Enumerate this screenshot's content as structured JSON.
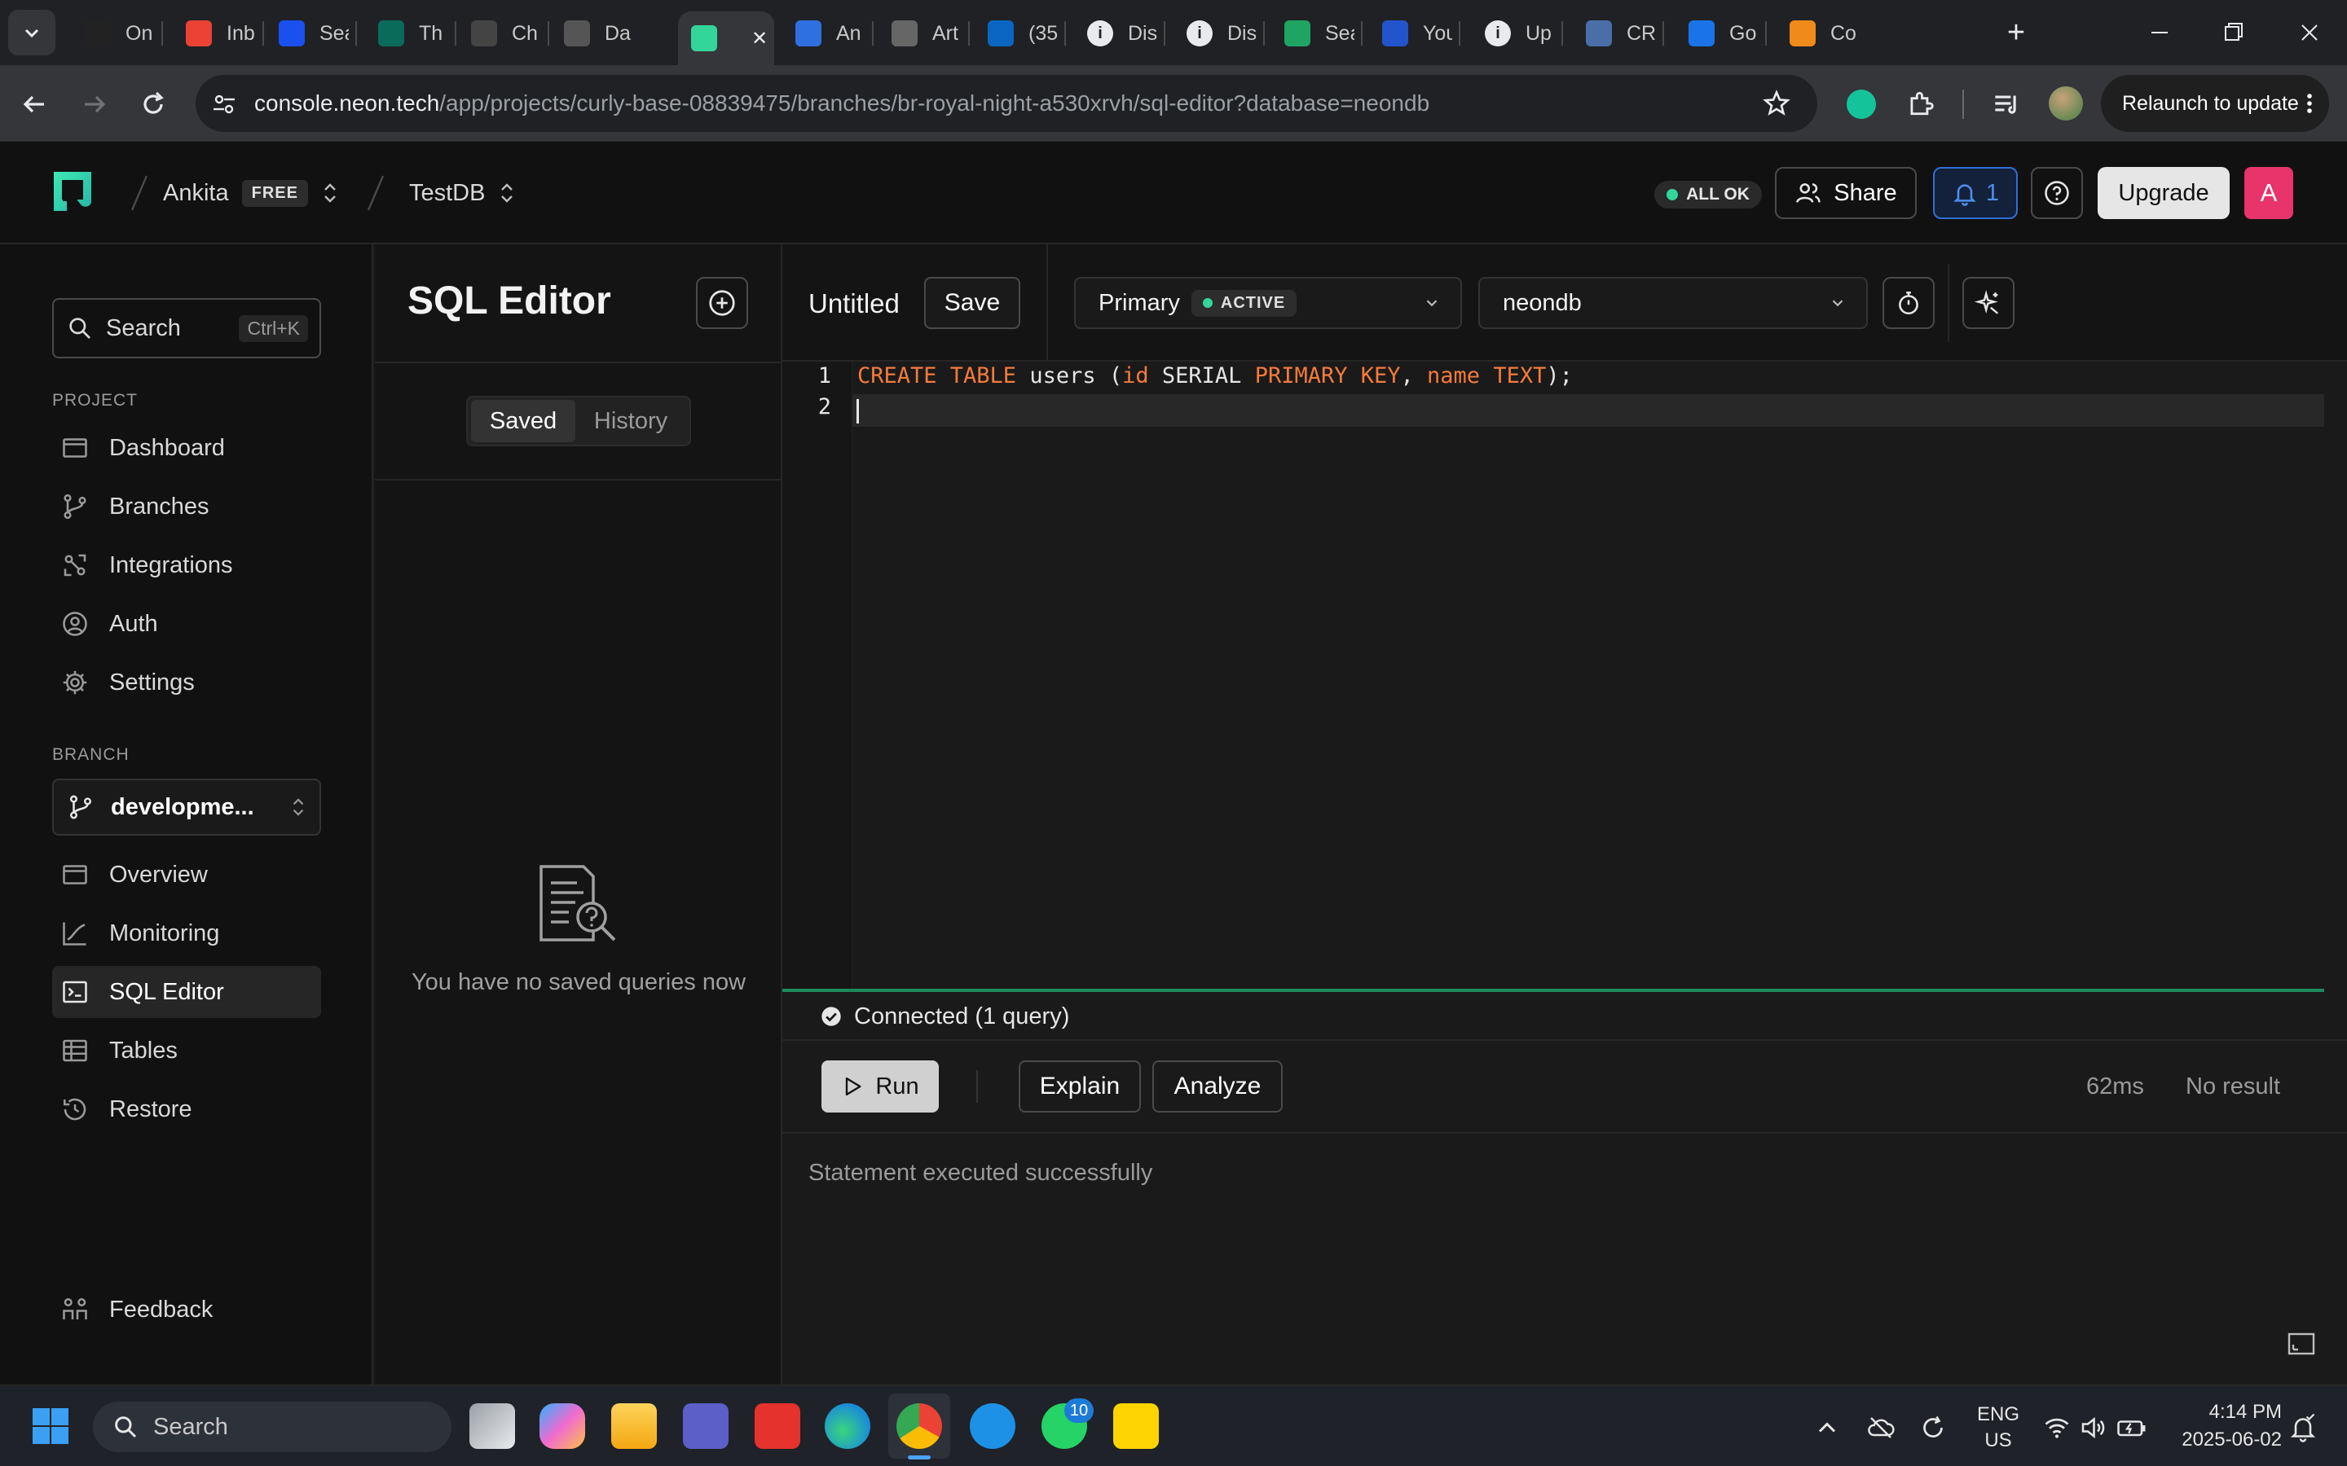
{
  "browser": {
    "tabs": [
      {
        "label": "On",
        "icon": "on-tab-icon"
      },
      {
        "label": "Inb",
        "icon": "gmail-icon"
      },
      {
        "label": "Sea",
        "icon": "search-tab-icon"
      },
      {
        "label": "Th",
        "icon": "th-tab-icon"
      },
      {
        "label": "Ch",
        "icon": "github-icon"
      },
      {
        "label": "Da",
        "icon": "openai-icon"
      },
      {
        "label": "",
        "icon": "neon-tab-icon",
        "active": true
      },
      {
        "label": "An",
        "icon": "an-tab-icon"
      },
      {
        "label": "Art",
        "icon": "globe-icon"
      },
      {
        "label": "(35",
        "icon": "linkedin-icon"
      },
      {
        "label": "Dis",
        "icon": "info-icon"
      },
      {
        "label": "Dis",
        "icon": "info-icon"
      },
      {
        "label": "Sea",
        "icon": "sea-tab-icon"
      },
      {
        "label": "You",
        "icon": "you-tab-icon"
      },
      {
        "label": "Up",
        "icon": "info-icon"
      },
      {
        "label": "CR",
        "icon": "cr-tab-icon"
      },
      {
        "label": "Go",
        "icon": "go-tab-icon"
      },
      {
        "label": "Co",
        "icon": "co-tab-icon"
      }
    ],
    "url_host": "console.neon.tech",
    "url_path": "/app/projects/curly-base-08839475/branches/br-royal-night-a530xrvh/sql-editor?database=neondb",
    "relaunch_label": "Relaunch to update"
  },
  "header": {
    "org_name": "Ankita",
    "plan_badge": "FREE",
    "project_name": "TestDB",
    "status_text": "ALL OK",
    "share_label": "Share",
    "notification_count": "1",
    "upgrade_label": "Upgrade",
    "avatar_letter": "A"
  },
  "sidebar": {
    "search_placeholder": "Search",
    "search_shortcut": "Ctrl+K",
    "project_label": "PROJECT",
    "project_items": [
      {
        "label": "Dashboard",
        "icon": "dashboard-icon"
      },
      {
        "label": "Branches",
        "icon": "branch-icon"
      },
      {
        "label": "Integrations",
        "icon": "integrations-icon"
      },
      {
        "label": "Auth",
        "icon": "auth-icon"
      },
      {
        "label": "Settings",
        "icon": "gear-icon"
      }
    ],
    "branch_label": "BRANCH",
    "branch_name": "developme...",
    "branch_items": [
      {
        "label": "Overview",
        "icon": "overview-icon"
      },
      {
        "label": "Monitoring",
        "icon": "monitoring-icon"
      },
      {
        "label": "SQL Editor",
        "icon": "sql-editor-icon",
        "active": true
      },
      {
        "label": "Tables",
        "icon": "tables-icon"
      },
      {
        "label": "Restore",
        "icon": "restore-icon"
      }
    ],
    "feedback_label": "Feedback"
  },
  "saved_panel": {
    "title": "SQL Editor",
    "tab_saved": "Saved",
    "tab_history": "History",
    "empty_message": "You have no saved queries now"
  },
  "editor": {
    "query_name": "Untitled",
    "save_label": "Save",
    "compute_name": "Primary",
    "compute_status": "ACTIVE",
    "database_name": "neondb",
    "lines": [
      {
        "number": "1",
        "tokens": [
          {
            "t": "CREATE TABLE",
            "k": "kw"
          },
          {
            "t": " users (",
            "k": "id"
          },
          {
            "t": "id",
            "k": "kw"
          },
          {
            "t": " SERIAL ",
            "k": "id"
          },
          {
            "t": "PRIMARY KEY",
            "k": "kw"
          },
          {
            "t": ", ",
            "k": "id"
          },
          {
            "t": "name",
            "k": "kw"
          },
          {
            "t": " ",
            "k": "id"
          },
          {
            "t": "TEXT",
            "k": "kw"
          },
          {
            "t": ");",
            "k": "id"
          }
        ]
      },
      {
        "number": "2",
        "tokens": []
      }
    ],
    "connection_status": "Connected (1 query)",
    "run_label": "Run",
    "explain_label": "Explain",
    "analyze_label": "Analyze",
    "timing": "62ms",
    "result_summary": "No result",
    "result_message": "Statement executed successfully"
  },
  "taskbar": {
    "search_placeholder": "Search",
    "whatsapp_badge": "10",
    "lang_primary": "ENG",
    "lang_secondary": "US",
    "time": "4:14 PM",
    "date": "2025-06-02"
  },
  "colors": {
    "accent_green": "#34d59a",
    "keyword_orange": "#f47b3b",
    "avatar_pink": "#e8336b",
    "notification_blue": "#3b82f6"
  }
}
